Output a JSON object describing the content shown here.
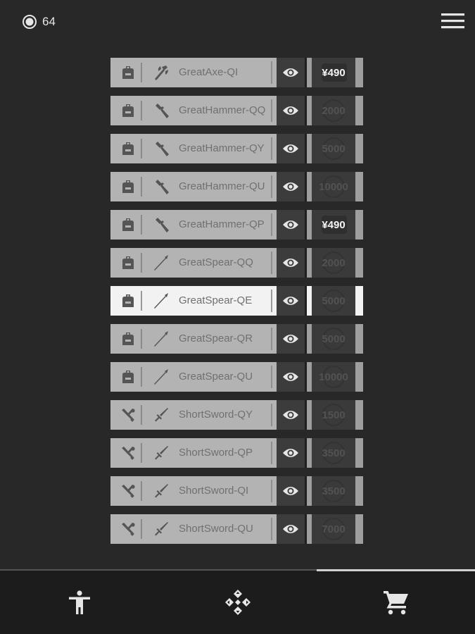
{
  "header": {
    "coins": "64",
    "coin_icon": "coin-icon",
    "menu_icon": "hamburger-menu-icon"
  },
  "items": [
    {
      "name": "GreatAxe-QI",
      "type": "axe",
      "lead": "backpack",
      "price": "¥490",
      "price_kind": "currency"
    },
    {
      "name": "GreatHammer-QQ",
      "type": "hammer",
      "lead": "backpack",
      "price": "2000",
      "price_kind": "coin"
    },
    {
      "name": "GreatHammer-QY",
      "type": "hammer",
      "lead": "backpack",
      "price": "5000",
      "price_kind": "coin"
    },
    {
      "name": "GreatHammer-QU",
      "type": "hammer",
      "lead": "backpack",
      "price": "10000",
      "price_kind": "coin"
    },
    {
      "name": "GreatHammer-QP",
      "type": "hammer",
      "lead": "backpack",
      "price": "¥490",
      "price_kind": "currency"
    },
    {
      "name": "GreatSpear-QQ",
      "type": "spear",
      "lead": "backpack",
      "price": "2000",
      "price_kind": "coin"
    },
    {
      "name": "GreatSpear-QE",
      "type": "spear",
      "lead": "backpack",
      "price": "5000",
      "price_kind": "coin",
      "selected": true
    },
    {
      "name": "GreatSpear-QR",
      "type": "spear",
      "lead": "backpack",
      "price": "5000",
      "price_kind": "coin"
    },
    {
      "name": "GreatSpear-QU",
      "type": "spear",
      "lead": "backpack",
      "price": "10000",
      "price_kind": "coin"
    },
    {
      "name": "ShortSword-QY",
      "type": "sword",
      "lead": "crossed-weapons",
      "price": "1500",
      "price_kind": "coin"
    },
    {
      "name": "ShortSword-QP",
      "type": "sword",
      "lead": "crossed-weapons",
      "price": "3500",
      "price_kind": "coin"
    },
    {
      "name": "ShortSword-QI",
      "type": "sword",
      "lead": "crossed-weapons",
      "price": "3500",
      "price_kind": "coin"
    },
    {
      "name": "ShortSword-QU",
      "type": "sword",
      "lead": "crossed-weapons",
      "price": "7000",
      "price_kind": "coin"
    }
  ],
  "bottom_nav": {
    "tabs": [
      {
        "icon": "person-icon"
      },
      {
        "icon": "dpad-icon"
      },
      {
        "icon": "cart-icon",
        "active": true
      }
    ]
  },
  "colors": {
    "background": "#282828",
    "row_bg": "#b3b3b3",
    "row_selected_bg": "#f2f2f2",
    "item_text": "#707070",
    "price_text_dim": "#525252",
    "price_text_currency": "#f5f5f5"
  }
}
